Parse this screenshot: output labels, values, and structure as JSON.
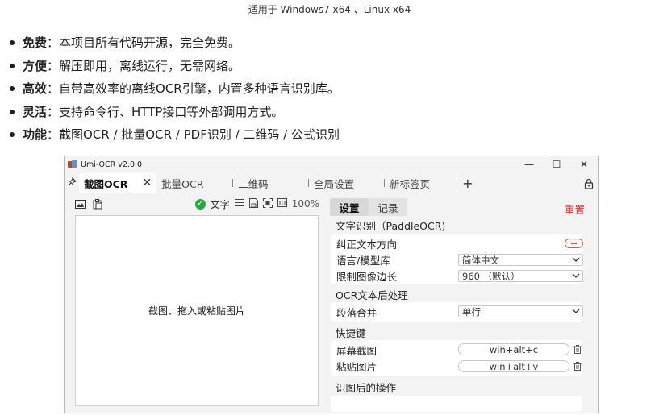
{
  "subtitle": "适用于 Windows7 x64 、Linux x64",
  "features": [
    {
      "name": "免费",
      "desc": "：本项目所有代码开源，完全免费。"
    },
    {
      "name": "方便",
      "desc": "：解压即用，离线运行，无需网络。"
    },
    {
      "name": "高效",
      "desc": "：自带高效率的离线OCR引擎，内置多种语言识别库。"
    },
    {
      "name": "灵活",
      "desc": "：支持命令行、HTTP接口等外部调用方式。"
    },
    {
      "name": "功能",
      "desc": "：截图OCR / 批量OCR / PDF识别 / 二维码 / 公式识别"
    }
  ],
  "window": {
    "title": "Umi-OCR v2.0.0",
    "controls": {
      "minimize": "—",
      "maximize": "☐",
      "close": "✕"
    }
  },
  "tabs": {
    "pin_icon": "pin-icon",
    "items": [
      {
        "label": "截图OCR",
        "close": "✕"
      },
      {
        "label": "批量OCR"
      },
      {
        "label": "二维码"
      },
      {
        "label": "全局设置"
      },
      {
        "label": "新标签页"
      }
    ],
    "add": "+"
  },
  "left_panel": {
    "ocr_toggle_label": "文字",
    "zoom": "100%",
    "drop_hint": "截图、拖入或粘贴图片"
  },
  "right_panel": {
    "tabs": [
      "设置",
      "记录"
    ],
    "reset": "重置",
    "sections": {
      "ocr": "文字识别（PaddleOCR)",
      "post": "OCR文本后处理",
      "hotkey": "快捷键",
      "after": "识图后的操作"
    },
    "ocr_rows": {
      "correct_dir": "纠正文本方向",
      "lang_model": "语言/模型库",
      "lang_value": "简体中文",
      "limit_side": "限制图像边长",
      "limit_value": "960 （默认）"
    },
    "post_rows": {
      "merge": "段落合并",
      "merge_value": "单行"
    },
    "hotkey_rows": {
      "screenshot": "屏幕截图",
      "screenshot_key": "win+alt+c",
      "paste": "粘贴图片",
      "paste_key": "win+alt+v"
    }
  },
  "colors": {
    "accent_red": "#e02020",
    "check_green": "#27a844",
    "panel_bg": "#f3f3f3"
  }
}
